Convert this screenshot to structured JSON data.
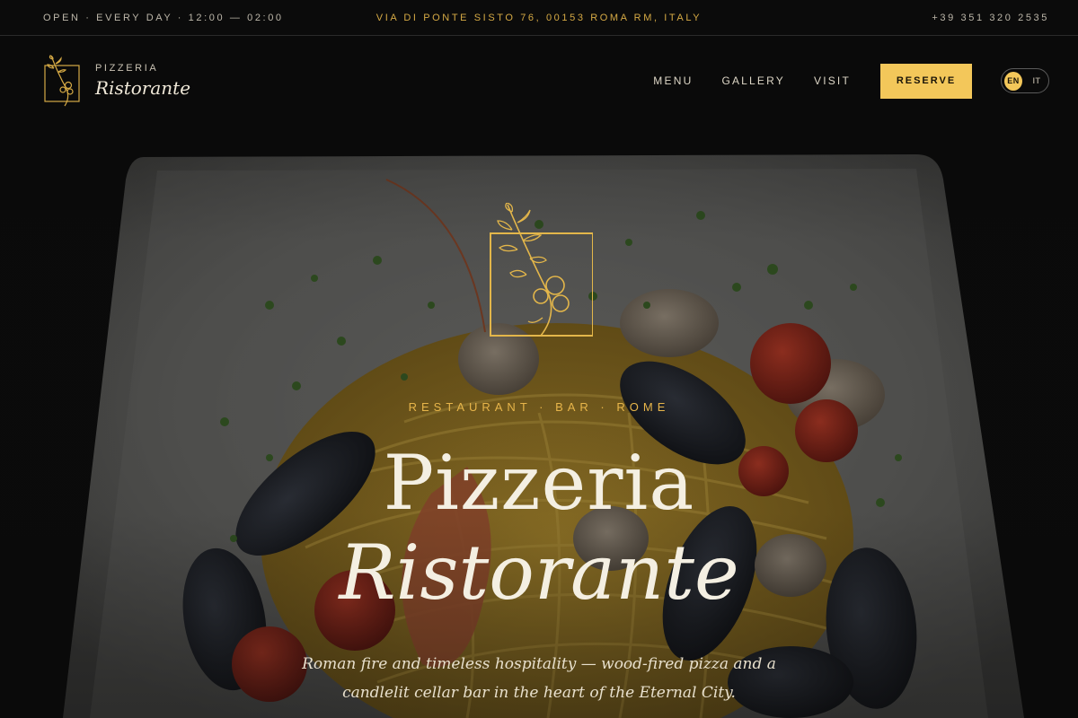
{
  "topbar": {
    "hours": "OPEN · EVERY DAY · 12:00 — 02:00",
    "address": "VIA DI PONTE SISTO 76, 00153 ROMA RM, ITALY",
    "phone": "+39 351 320 2535"
  },
  "brand": {
    "eyebrow": "PIZZERIA",
    "name": "Ristorante",
    "logo_icon": "olive-branch-frame-icon"
  },
  "nav": {
    "items": [
      {
        "label": "MENU"
      },
      {
        "label": "GALLERY"
      },
      {
        "label": "VISIT"
      }
    ],
    "reserve_label": "RESERVE",
    "languages": [
      {
        "code": "EN",
        "active": true
      },
      {
        "code": "IT",
        "active": false
      }
    ]
  },
  "hero": {
    "kicker": "RESTAURANT · BAR · ROME",
    "title_line1": "Pizzeria",
    "title_line2": "Ristorante",
    "tagline": "Roman fire and timeless hospitality — wood-fired pizza and a candlelit cellar bar in the heart of the Eternal City.",
    "emblem_icon": "olive-branch-frame-icon",
    "background_image": "seafood-spaghetti-plate"
  },
  "colors": {
    "accent": "#f3c75a",
    "gold_text": "#d6aa45",
    "background": "#0b0b0b",
    "cream_text": "#f4efe2"
  }
}
